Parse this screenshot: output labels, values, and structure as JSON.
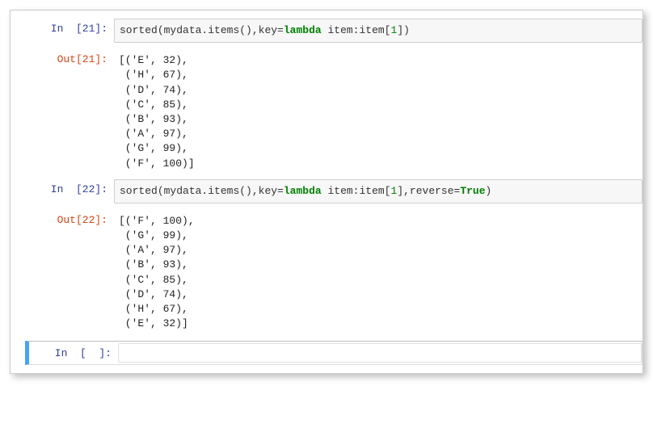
{
  "cells": [
    {
      "in_label": "In  [21]:",
      "code": {
        "prefix": "sorted",
        "open": "(",
        "body": "mydata.items(),key=",
        "lambda": "lambda",
        "after_lambda": " item:item[",
        "num": "1",
        "tail": "]",
        "close": ")"
      },
      "out_label": "Out[21]:",
      "output": "[('E', 32),\n ('H', 67),\n ('D', 74),\n ('C', 85),\n ('B', 93),\n ('A', 97),\n ('G', 99),\n ('F', 100)]"
    },
    {
      "in_label": "In  [22]:",
      "code": {
        "prefix": "sorted",
        "open": "(",
        "body": "mydata.items(),key=",
        "lambda": "lambda",
        "after_lambda": " item:item[",
        "num": "1",
        "tail": "],reverse=",
        "true_kw": "True",
        "close": ")"
      },
      "out_label": "Out[22]:",
      "output": "[('F', 100),\n ('G', 99),\n ('A', 97),\n ('B', 93),\n ('C', 85),\n ('D', 74),\n ('H', 67),\n ('E', 32)]"
    },
    {
      "in_label": "In  [  ]:",
      "empty": true
    }
  ]
}
